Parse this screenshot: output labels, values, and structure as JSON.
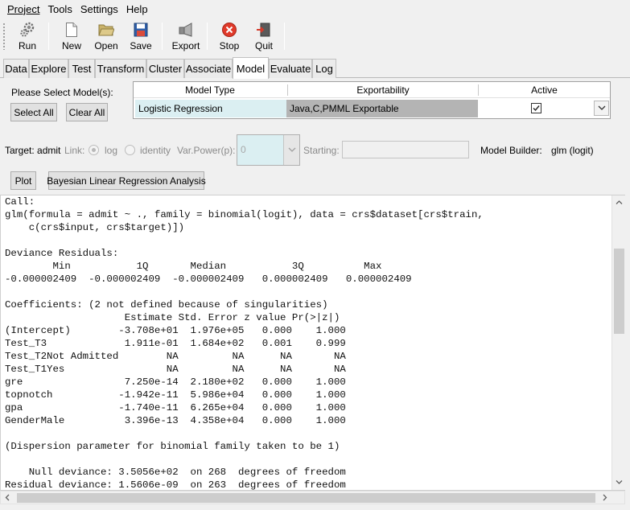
{
  "menu": [
    "Project",
    "Tools",
    "Settings",
    "Help"
  ],
  "toolbar": {
    "run": "Run",
    "new": "New",
    "open": "Open",
    "save": "Save",
    "export": "Export",
    "stop": "Stop",
    "quit": "Quit"
  },
  "tabs": [
    "Data",
    "Explore",
    "Test",
    "Transform",
    "Cluster",
    "Associate",
    "Model",
    "Evaluate",
    "Log"
  ],
  "active_tab": "Model",
  "model_select": {
    "prompt": "Please Select Model(s):",
    "select_all": "Select All",
    "clear_all": "Clear All",
    "columns": [
      "Model Type",
      "Exportability",
      "Active"
    ],
    "row": {
      "model_type": "Logistic Regression",
      "exportability": "Java,C,PMML Exportable",
      "active": true
    }
  },
  "options": {
    "target_label": "Target: admit",
    "link_label": "Link:",
    "link_options": [
      "log",
      "identity"
    ],
    "var_power_label": "Var.Power(p):",
    "var_power_value": "0",
    "starting_label": "Starting:",
    "starting_value": "",
    "model_builder_label": "Model Builder:",
    "model_builder_value": "glm (logit)"
  },
  "actions": {
    "plot": "Plot",
    "bayesian": "Bayesian Linear Regression Analysis"
  },
  "output_lines": [
    "Call:",
    "glm(formula = admit ~ ., family = binomial(logit), data = crs$dataset[crs$train,",
    "    c(crs$input, crs$target)])",
    "",
    "Deviance Residuals:",
    "        Min           1Q       Median           3Q          Max",
    "-0.000002409  -0.000002409  -0.000002409   0.000002409   0.000002409",
    "",
    "Coefficients: (2 not defined because of singularities)",
    "                    Estimate Std. Error z value Pr(>|z|)",
    "(Intercept)        -3.708e+01  1.976e+05   0.000    1.000",
    "Test_T3             1.911e-01  1.684e+02   0.001    0.999",
    "Test_T2Not Admitted        NA         NA      NA       NA",
    "Test_T1Yes                 NA         NA      NA       NA",
    "gre                 7.250e-14  2.180e+02   0.000    1.000",
    "topnotch           -1.942e-11  5.986e+04   0.000    1.000",
    "gpa                -1.740e-11  6.265e+04   0.000    1.000",
    "GenderMale          3.396e-13  4.358e+04   0.000    1.000",
    "",
    "(Dispersion parameter for binomial family taken to be 1)",
    "",
    "    Null deviance: 3.5056e+02  on 268  degrees of freedom",
    "Residual deviance: 1.5606e-09  on 263  degrees of freedom"
  ],
  "colors": {
    "stop_red": "#e03a2a",
    "model_type_bg": "#dbeff2",
    "exportability_bg": "#b4b4b4"
  }
}
